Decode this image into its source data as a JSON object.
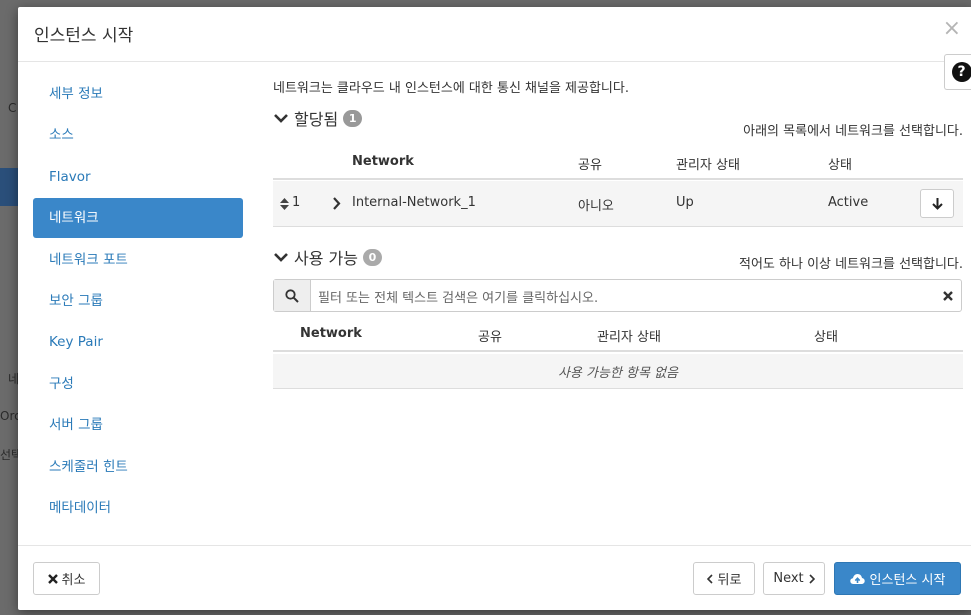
{
  "background": {
    "fragments": [
      "C",
      "네",
      "Orch",
      "선택"
    ]
  },
  "modal": {
    "title": "인스턴스 시작",
    "close_symbol": "×",
    "help_symbol": "?"
  },
  "sidebar": {
    "items": [
      {
        "label": "세부 정보"
      },
      {
        "label": "소스"
      },
      {
        "label": "Flavor"
      },
      {
        "label": "네트워크",
        "active": true
      },
      {
        "label": "네트워크 포트"
      },
      {
        "label": "보안 그룹"
      },
      {
        "label": "Key Pair"
      },
      {
        "label": "구성"
      },
      {
        "label": "서버 그룹"
      },
      {
        "label": "스케줄러 힌트"
      },
      {
        "label": "메타데이터"
      }
    ]
  },
  "main": {
    "intro": "네트워크는 클라우드 내 인스턴스에 대한 통신 채널을 제공합니다.",
    "allocated": {
      "title": "할당됨",
      "count": "1",
      "help": "아래의 목록에서 네트워크를 선택합니다.",
      "columns": [
        "Network",
        "공유",
        "관리자 상태",
        "상태"
      ],
      "rows": [
        {
          "order": "1",
          "network": "Internal-Network_1",
          "shared": "아니오",
          "admin_state": "Up",
          "status": "Active"
        }
      ]
    },
    "available": {
      "title": "사용 가능",
      "count": "0",
      "help": "적어도 하나 이상 네트워크를 선택합니다.",
      "search_placeholder": "필터 또는 전체 텍스트 검색은 여기를 클릭하십시오.",
      "columns": [
        "Network",
        "공유",
        "관리자 상태",
        "상태"
      ],
      "empty": "사용 가능한 항목 없음"
    }
  },
  "footer": {
    "cancel": "취소",
    "back": "뒤로",
    "next": "Next",
    "launch": "인스턴스 시작"
  }
}
